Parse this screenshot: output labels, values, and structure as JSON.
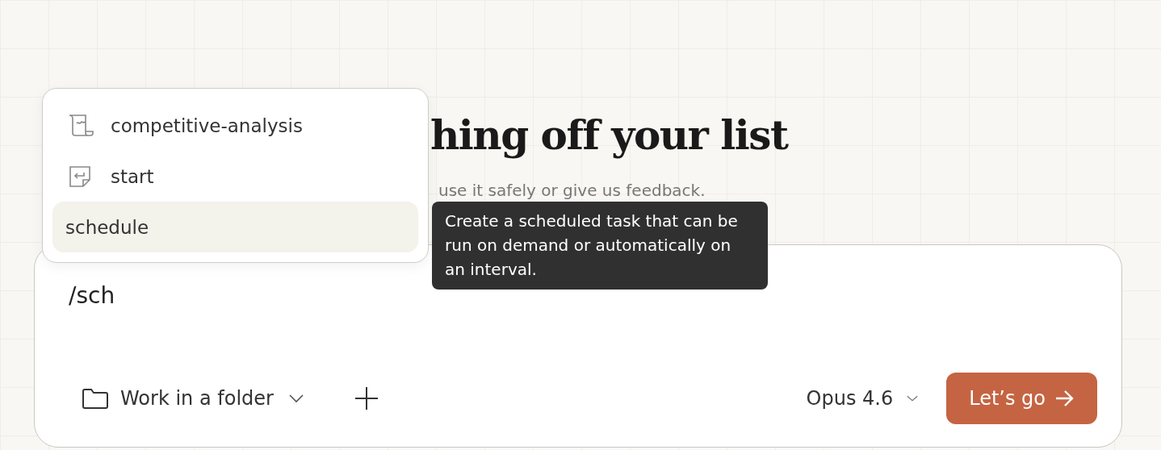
{
  "heading": "hing off your list",
  "subtitle": "use it safely or give us feedback.",
  "command_menu": {
    "items": [
      {
        "label": "competitive-analysis",
        "kind": "scroll",
        "selected": false
      },
      {
        "label": "start",
        "kind": "enter",
        "selected": false
      },
      {
        "label": "schedule",
        "kind": "plain",
        "selected": true
      }
    ]
  },
  "tooltip": "Create a scheduled task that can be run on demand or automatically on an interval.",
  "composer": {
    "value": "/sch",
    "folder_button": "Work in a folder",
    "model": "Opus 4.6",
    "submit": "Let’s go"
  }
}
